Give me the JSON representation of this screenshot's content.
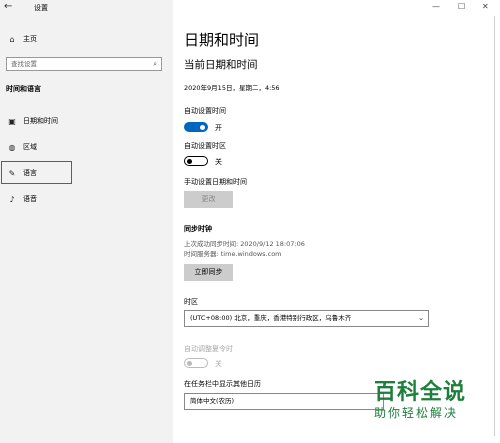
{
  "window": {
    "title": "设置",
    "back_glyph": "←",
    "minimize": "—",
    "maximize": "☐",
    "close": "✕"
  },
  "sidebar": {
    "home_label": "主页",
    "search_placeholder": "查找设置",
    "section_title": "时间和语言",
    "items": [
      {
        "label": "日期和时间",
        "icon": "calendar-clock-icon"
      },
      {
        "label": "区域",
        "icon": "globe-icon"
      },
      {
        "label": "语言",
        "icon": "language-icon",
        "highlighted": true
      },
      {
        "label": "语音",
        "icon": "microphone-icon"
      }
    ]
  },
  "main": {
    "title": "日期和时间",
    "current_header": "当前日期和时间",
    "current_datetime": "2020年9月15日，星期二，4:56",
    "auto_time_label": "自动设置时间",
    "auto_time_state": "开",
    "auto_timezone_label": "自动设置时区",
    "auto_timezone_state": "关",
    "manual_label": "手动设置日期和时间",
    "change_button": "更改",
    "sync_header": "同步时钟",
    "last_sync": "上次成功同步时间: 2020/9/12 18:07:06",
    "time_server": "时间服务器: time.windows.com",
    "sync_button": "立即同步",
    "timezone_label": "时区",
    "timezone_value": "(UTC+08:00) 北京，重庆，香港特别行政区，乌鲁木齐",
    "dst_label": "自动调整夏令时",
    "dst_state": "关",
    "calendar_label": "在任务栏中显示其他日历",
    "calendar_value": "简体中文(农历)"
  },
  "watermark": {
    "top": "百科全说",
    "bottom": "助你轻松解决"
  },
  "colors": {
    "accent": "#0067c0",
    "highlight_box": "#e52429",
    "watermark": "#1d7f3b"
  }
}
